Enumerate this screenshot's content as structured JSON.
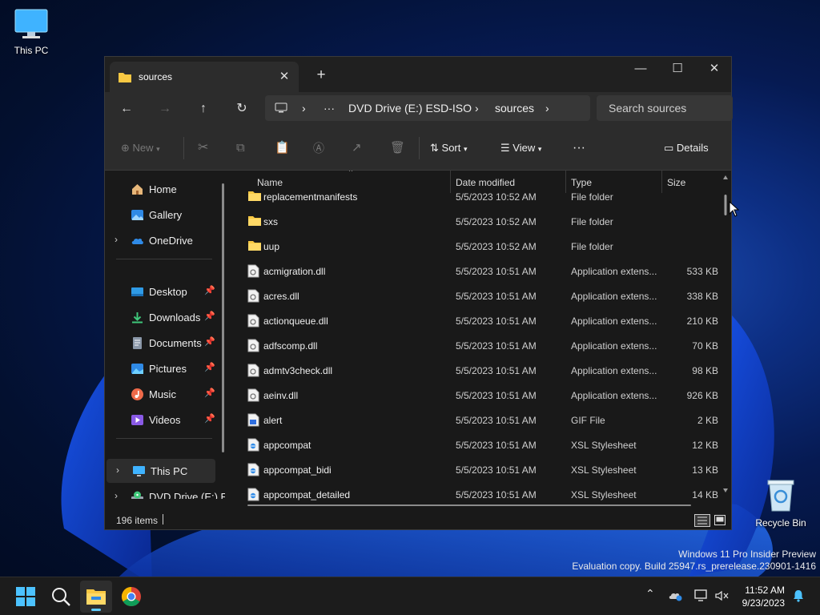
{
  "desktop": {
    "this_pc_label": "This PC",
    "recycle_bin_label": "Recycle Bin",
    "watermark_line1": "Windows 11 Pro Insider Preview",
    "watermark_line2": "Evaluation copy. Build 25947.rs_prerelease.230901-1416"
  },
  "window": {
    "tab_title": "sources",
    "new_tab": "+",
    "breadcrumb": [
      "DVD Drive (E:) ESD-ISO",
      "sources"
    ],
    "breadcrumb_more": "···",
    "search_placeholder": "Search sources",
    "toolbar": {
      "new_label": "New",
      "sort_label": "Sort",
      "view_label": "View",
      "more_label": "···",
      "details_label": "Details"
    },
    "nav": {
      "home": "Home",
      "gallery": "Gallery",
      "onedrive": "OneDrive",
      "desktop": "Desktop",
      "downloads": "Downloads",
      "documents": "Documents",
      "pictures": "Pictures",
      "music": "Music",
      "videos": "Videos",
      "this_pc": "This PC",
      "dvd": "DVD Drive (E:) ES"
    },
    "columns": {
      "name": "Name",
      "date": "Date modified",
      "type": "Type",
      "size": "Size"
    },
    "files": [
      {
        "name": "replacementmanifests",
        "date": "5/5/2023 10:52 AM",
        "type": "File folder",
        "size": "",
        "kind": "folder"
      },
      {
        "name": "sxs",
        "date": "5/5/2023 10:52 AM",
        "type": "File folder",
        "size": "",
        "kind": "folder"
      },
      {
        "name": "uup",
        "date": "5/5/2023 10:52 AM",
        "type": "File folder",
        "size": "",
        "kind": "folder"
      },
      {
        "name": "acmigration.dll",
        "date": "5/5/2023 10:51 AM",
        "type": "Application extens...",
        "size": "533 KB",
        "kind": "dll"
      },
      {
        "name": "acres.dll",
        "date": "5/5/2023 10:51 AM",
        "type": "Application extens...",
        "size": "338 KB",
        "kind": "dll"
      },
      {
        "name": "actionqueue.dll",
        "date": "5/5/2023 10:51 AM",
        "type": "Application extens...",
        "size": "210 KB",
        "kind": "dll"
      },
      {
        "name": "adfscomp.dll",
        "date": "5/5/2023 10:51 AM",
        "type": "Application extens...",
        "size": "70 KB",
        "kind": "dll"
      },
      {
        "name": "admtv3check.dll",
        "date": "5/5/2023 10:51 AM",
        "type": "Application extens...",
        "size": "98 KB",
        "kind": "dll"
      },
      {
        "name": "aeinv.dll",
        "date": "5/5/2023 10:51 AM",
        "type": "Application extens...",
        "size": "926 KB",
        "kind": "dll"
      },
      {
        "name": "alert",
        "date": "5/5/2023 10:51 AM",
        "type": "GIF File",
        "size": "2 KB",
        "kind": "gif"
      },
      {
        "name": "appcompat",
        "date": "5/5/2023 10:51 AM",
        "type": "XSL Stylesheet",
        "size": "12 KB",
        "kind": "xsl"
      },
      {
        "name": "appcompat_bidi",
        "date": "5/5/2023 10:51 AM",
        "type": "XSL Stylesheet",
        "size": "13 KB",
        "kind": "xsl"
      },
      {
        "name": "appcompat_detailed",
        "date": "5/5/2023 10:51 AM",
        "type": "XSL Stylesheet",
        "size": "14 KB",
        "kind": "xsl"
      }
    ],
    "status_items": "196 items"
  },
  "taskbar": {
    "time": "11:52 AM",
    "date": "9/23/2023"
  },
  "colors": {
    "accent": "#60cdff",
    "folder": "#f8c843"
  }
}
